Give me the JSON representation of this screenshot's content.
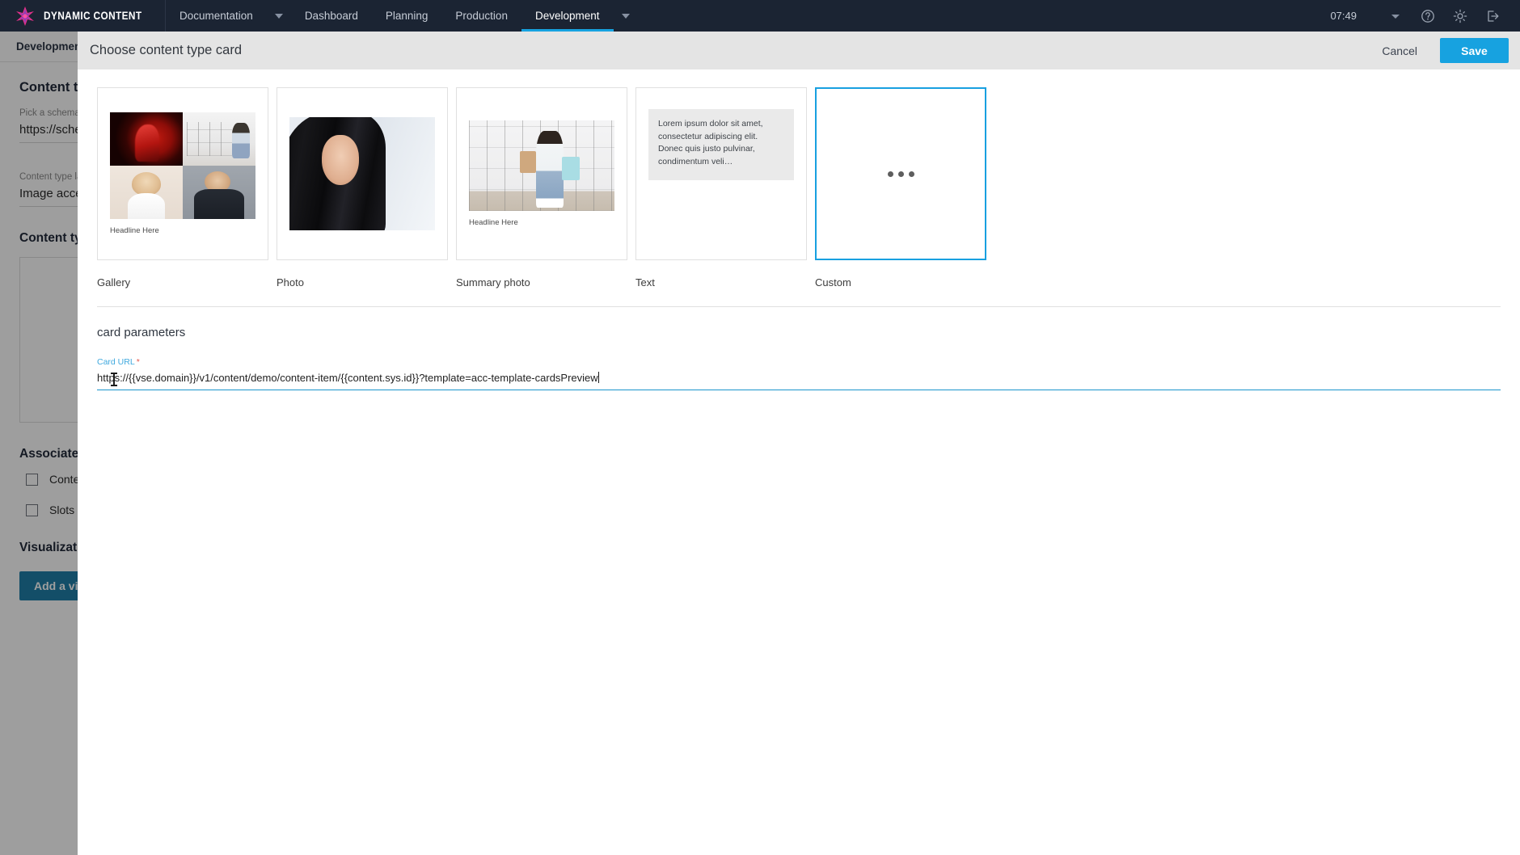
{
  "topnav": {
    "brand": "DYNAMIC CONTENT",
    "items": [
      {
        "label": "Documentation",
        "caret": true,
        "active": false
      },
      {
        "label": "Dashboard",
        "caret": false,
        "active": false
      },
      {
        "label": "Planning",
        "caret": false,
        "active": false
      },
      {
        "label": "Production",
        "caret": false,
        "active": false
      },
      {
        "label": "Development",
        "caret": true,
        "active": true
      }
    ],
    "time": "07:49",
    "icons": [
      "chevron-down-icon",
      "help-icon",
      "gear-icon",
      "logout-icon"
    ]
  },
  "background": {
    "subbar_title": "Development",
    "heading": "Content type",
    "schema_label": "Pick a schema",
    "schema_value": "https://schem",
    "label_label": "Content type label",
    "label_value": "Image accele",
    "card_heading": "Content type",
    "associated_heading": "Associated",
    "checkboxes": [
      "Content",
      "Slots"
    ],
    "visualization_heading": "Visualization",
    "add_visualization_button": "Add a vis"
  },
  "modal": {
    "title": "Choose content type card",
    "cancel_label": "Cancel",
    "save_label": "Save",
    "cards": [
      {
        "label": "Gallery",
        "kind": "gallery",
        "headline": "Headline Here",
        "selected": false
      },
      {
        "label": "Photo",
        "kind": "photo",
        "selected": false
      },
      {
        "label": "Summary photo",
        "kind": "summary",
        "headline": "Headline Here",
        "selected": false
      },
      {
        "label": "Text",
        "kind": "text",
        "body": "Lorem ipsum dolor sit amet, consectetur adipiscing elit. Donec quis justo pulvinar, condimentum veli…",
        "selected": false
      },
      {
        "label": "Custom",
        "kind": "custom",
        "selected": true
      }
    ],
    "params_title": "card parameters",
    "card_url": {
      "label": "Card URL",
      "required_marker": "*",
      "value": "https://{{vse.domain}}/v1/content/demo/content-item/{{content.sys.id}}?template=acc-template-cardsPreview"
    }
  },
  "colors": {
    "header_bg": "#1b2433",
    "accent_blue": "#17a2e0",
    "selected_border": "#18a0e0",
    "required_red": "#e2574c",
    "modal_header_bg": "#e4e4e4"
  }
}
